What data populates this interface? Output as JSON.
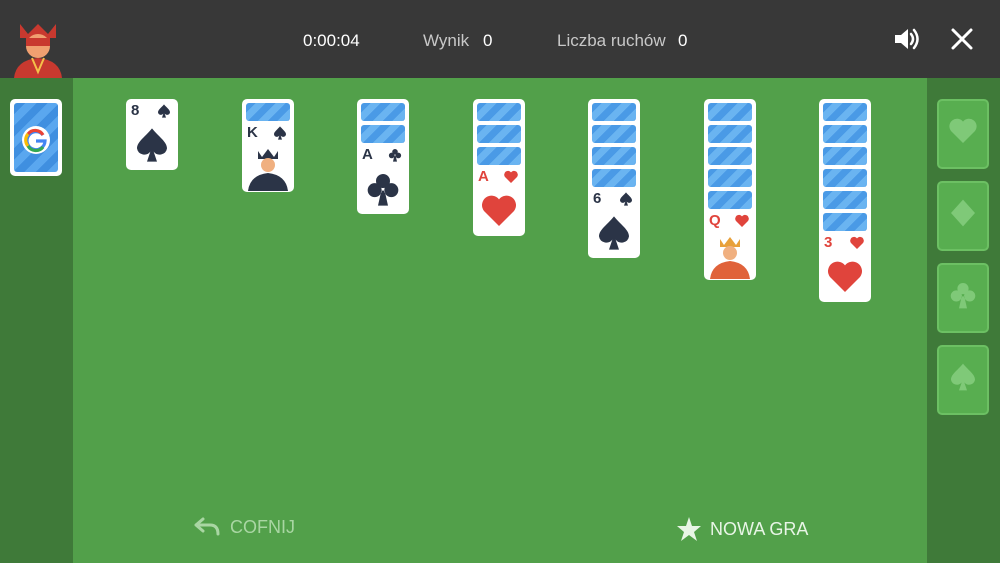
{
  "header": {
    "timer": "0:00:04",
    "score_label": "Wynik",
    "score_value": "0",
    "moves_label": "Liczba ruchów",
    "moves_value": "0",
    "sound_icon": "speaker-icon",
    "close_icon": "close-icon"
  },
  "stock": {
    "logo_letter": "G"
  },
  "foundations": [
    {
      "suit": "heart",
      "icon": "heart-icon"
    },
    {
      "suit": "diamond",
      "icon": "diamond-icon"
    },
    {
      "suit": "club",
      "icon": "club-icon"
    },
    {
      "suit": "spade",
      "icon": "spade-icon"
    }
  ],
  "tableau": [
    {
      "face_down": 0,
      "rank": "8",
      "suit": "spade"
    },
    {
      "face_down": 1,
      "rank": "K",
      "suit": "spade"
    },
    {
      "face_down": 2,
      "rank": "A",
      "suit": "club"
    },
    {
      "face_down": 3,
      "rank": "A",
      "suit": "heart"
    },
    {
      "face_down": 4,
      "rank": "6",
      "suit": "spade"
    },
    {
      "face_down": 5,
      "rank": "Q",
      "suit": "heart"
    },
    {
      "face_down": 6,
      "rank": "3",
      "suit": "heart"
    }
  ],
  "actions": {
    "undo_label": "COFNIJ",
    "new_game_label": "NOWA GRA"
  },
  "colors": {
    "table": "#52a04a",
    "topbar": "#383838",
    "red": "#e0443c",
    "black": "#2b3447"
  }
}
